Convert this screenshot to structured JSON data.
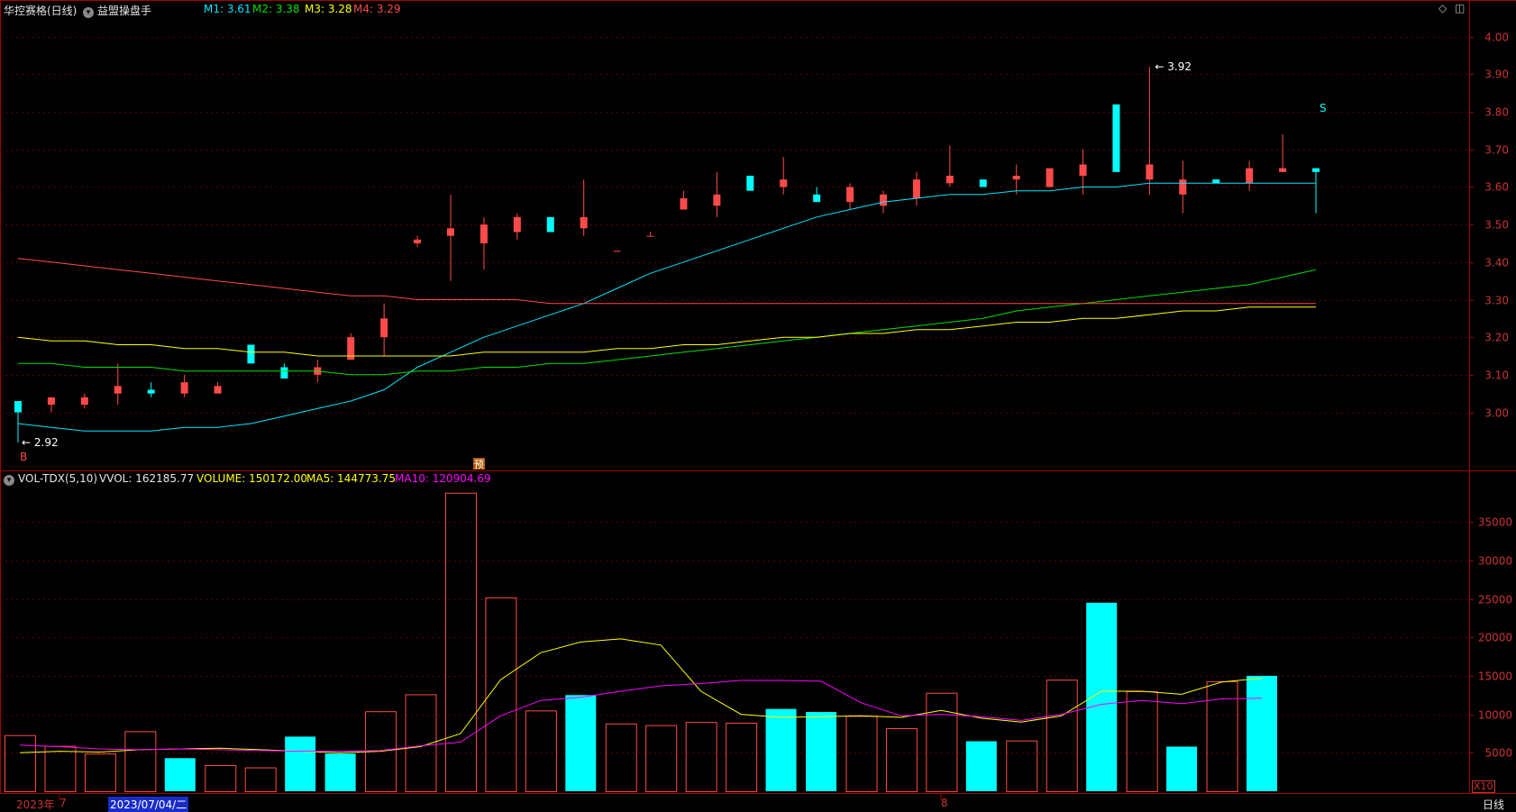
{
  "header": {
    "stock_name": "华控赛格(日线)",
    "indicator_name": "益盟操盘手",
    "ma_values": [
      {
        "label": "M1: 3.61",
        "color": "#00e5ff"
      },
      {
        "label": "M2: 3.38",
        "color": "#00e000"
      },
      {
        "label": "M3: 3.28",
        "color": "#ffff00"
      },
      {
        "label": "M4: 3.29",
        "color": "#ff4a4a"
      }
    ],
    "right_icons": [
      "diamond-icon",
      "panel-toggle-icon"
    ]
  },
  "volume_header": {
    "indicator": "VOL-TDX(5,10)",
    "vvol": "VVOL: 162185.77",
    "volume": "VOLUME: 150172.00",
    "ma5": "MA5: 144773.75",
    "ma10": "MA10: 120904.69"
  },
  "markers": {
    "low_label": "2.92",
    "high_label": "3.92",
    "buy_marker": "B",
    "sell_marker": "S",
    "pre_marker": "预"
  },
  "bottom_bar": {
    "year_label": "2023年",
    "month_start": "7",
    "cursor_date": "2023/07/04/二",
    "month_mid": "8",
    "period_label": "日线",
    "scale_label": "X10"
  },
  "colors": {
    "up": "#ff4a4a",
    "down": "#00ffff",
    "m1": "#00e5ff",
    "m2": "#00e000",
    "m3": "#ffff00",
    "m4": "#ff4a4a",
    "ma5": "#ffff00",
    "ma10": "#ff00ff",
    "axis": "#a00000"
  },
  "chart_data": [
    {
      "type": "candlestick",
      "title": "华控赛格(日线)",
      "ylim": [
        2.85,
        4.05
      ],
      "yticks": [
        "4.00",
        "3.90",
        "3.80",
        "3.70",
        "3.60",
        "3.50",
        "3.40",
        "3.30",
        "3.20",
        "3.10",
        "3.00"
      ],
      "candles": [
        {
          "o": 3.03,
          "c": 3.0,
          "h": 3.03,
          "l": 2.92
        },
        {
          "o": 3.02,
          "c": 3.04,
          "h": 3.04,
          "l": 3.0
        },
        {
          "o": 3.02,
          "c": 3.04,
          "h": 3.05,
          "l": 3.01
        },
        {
          "o": 3.05,
          "c": 3.07,
          "h": 3.13,
          "l": 3.02
        },
        {
          "o": 3.06,
          "c": 3.05,
          "h": 3.08,
          "l": 3.04
        },
        {
          "o": 3.05,
          "c": 3.08,
          "h": 3.1,
          "l": 3.04
        },
        {
          "o": 3.05,
          "c": 3.07,
          "h": 3.08,
          "l": 3.05
        },
        {
          "o": 3.18,
          "c": 3.13,
          "h": 3.18,
          "l": 3.13
        },
        {
          "o": 3.12,
          "c": 3.09,
          "h": 3.13,
          "l": 3.09
        },
        {
          "o": 3.1,
          "c": 3.12,
          "h": 3.14,
          "l": 3.08
        },
        {
          "o": 3.14,
          "c": 3.2,
          "h": 3.21,
          "l": 3.14
        },
        {
          "o": 3.2,
          "c": 3.25,
          "h": 3.29,
          "l": 3.15
        },
        {
          "o": 3.45,
          "c": 3.46,
          "h": 3.47,
          "l": 3.44
        },
        {
          "o": 3.47,
          "c": 3.49,
          "h": 3.58,
          "l": 3.35
        },
        {
          "o": 3.45,
          "c": 3.5,
          "h": 3.52,
          "l": 3.38
        },
        {
          "o": 3.48,
          "c": 3.52,
          "h": 3.53,
          "l": 3.46
        },
        {
          "o": 3.52,
          "c": 3.48,
          "h": 3.52,
          "l": 3.48
        },
        {
          "o": 3.49,
          "c": 3.52,
          "h": 3.62,
          "l": 3.47
        },
        {
          "o": 3.43,
          "c": 3.43,
          "h": 3.43,
          "l": 3.43
        },
        {
          "o": 3.47,
          "c": 3.47,
          "h": 3.48,
          "l": 3.47
        },
        {
          "o": 3.54,
          "c": 3.57,
          "h": 3.59,
          "l": 3.54
        },
        {
          "o": 3.55,
          "c": 3.58,
          "h": 3.64,
          "l": 3.52
        },
        {
          "o": 3.63,
          "c": 3.59,
          "h": 3.63,
          "l": 3.59
        },
        {
          "o": 3.6,
          "c": 3.62,
          "h": 3.68,
          "l": 3.58
        },
        {
          "o": 3.58,
          "c": 3.56,
          "h": 3.6,
          "l": 3.56
        },
        {
          "o": 3.56,
          "c": 3.6,
          "h": 3.61,
          "l": 3.54
        },
        {
          "o": 3.55,
          "c": 3.58,
          "h": 3.59,
          "l": 3.53
        },
        {
          "o": 3.57,
          "c": 3.62,
          "h": 3.64,
          "l": 3.55
        },
        {
          "o": 3.61,
          "c": 3.63,
          "h": 3.71,
          "l": 3.6
        },
        {
          "o": 3.62,
          "c": 3.6,
          "h": 3.62,
          "l": 3.6
        },
        {
          "o": 3.62,
          "c": 3.63,
          "h": 3.66,
          "l": 3.58
        },
        {
          "o": 3.6,
          "c": 3.65,
          "h": 3.65,
          "l": 3.6
        },
        {
          "o": 3.63,
          "c": 3.66,
          "h": 3.7,
          "l": 3.58
        },
        {
          "o": 3.82,
          "c": 3.64,
          "h": 3.82,
          "l": 3.64
        },
        {
          "o": 3.62,
          "c": 3.66,
          "h": 3.92,
          "l": 3.58
        },
        {
          "o": 3.58,
          "c": 3.62,
          "h": 3.67,
          "l": 3.53
        },
        {
          "o": 3.62,
          "c": 3.61,
          "h": 3.62,
          "l": 3.61
        },
        {
          "o": 3.61,
          "c": 3.65,
          "h": 3.67,
          "l": 3.59
        },
        {
          "o": 3.64,
          "c": 3.65,
          "h": 3.74,
          "l": 3.64
        },
        {
          "o": 3.65,
          "c": 3.64,
          "h": 3.65,
          "l": 3.53
        }
      ],
      "series": [
        {
          "name": "M1",
          "values": [
            2.97,
            2.96,
            2.95,
            2.95,
            2.95,
            2.96,
            2.96,
            2.97,
            2.99,
            3.01,
            3.03,
            3.06,
            3.12,
            3.16,
            3.2,
            3.23,
            3.26,
            3.29,
            3.33,
            3.37,
            3.4,
            3.43,
            3.46,
            3.49,
            3.52,
            3.54,
            3.56,
            3.57,
            3.58,
            3.58,
            3.59,
            3.59,
            3.6,
            3.6,
            3.61,
            3.61,
            3.61,
            3.61,
            3.61,
            3.61
          ]
        },
        {
          "name": "M2",
          "values": [
            3.13,
            3.13,
            3.12,
            3.12,
            3.12,
            3.11,
            3.11,
            3.11,
            3.11,
            3.11,
            3.1,
            3.1,
            3.11,
            3.11,
            3.12,
            3.12,
            3.13,
            3.13,
            3.14,
            3.15,
            3.16,
            3.17,
            3.18,
            3.19,
            3.2,
            3.21,
            3.22,
            3.23,
            3.24,
            3.25,
            3.27,
            3.28,
            3.29,
            3.3,
            3.31,
            3.32,
            3.33,
            3.34,
            3.36,
            3.38
          ]
        },
        {
          "name": "M3",
          "values": [
            3.2,
            3.19,
            3.19,
            3.18,
            3.18,
            3.17,
            3.17,
            3.16,
            3.16,
            3.15,
            3.15,
            3.15,
            3.15,
            3.15,
            3.16,
            3.16,
            3.16,
            3.16,
            3.17,
            3.17,
            3.18,
            3.18,
            3.19,
            3.2,
            3.2,
            3.21,
            3.21,
            3.22,
            3.22,
            3.23,
            3.24,
            3.24,
            3.25,
            3.25,
            3.26,
            3.27,
            3.27,
            3.28,
            3.28,
            3.28
          ]
        },
        {
          "name": "M4",
          "values": [
            3.41,
            3.4,
            3.39,
            3.38,
            3.37,
            3.36,
            3.35,
            3.34,
            3.33,
            3.32,
            3.31,
            3.31,
            3.3,
            3.3,
            3.3,
            3.3,
            3.29,
            3.29,
            3.29,
            3.29,
            3.29,
            3.29,
            3.29,
            3.29,
            3.29,
            3.29,
            3.29,
            3.29,
            3.29,
            3.29,
            3.29,
            3.29,
            3.29,
            3.29,
            3.29,
            3.29,
            3.29,
            3.29,
            3.29,
            3.29
          ]
        }
      ]
    },
    {
      "type": "bar",
      "title": "VOL-TDX(5,10)",
      "ylim": [
        0,
        39000
      ],
      "yticks": [
        35000,
        30000,
        25000,
        20000,
        15000,
        10000,
        5000
      ],
      "values": [
        7300,
        5900,
        4900,
        7800,
        4300,
        3400,
        3100,
        7100,
        4900,
        10400,
        12600,
        38800,
        25200,
        10500,
        12500,
        8800,
        8600,
        9000,
        8900,
        10700,
        10300,
        9800,
        8200,
        12800,
        6500,
        6600,
        14500,
        24500,
        13000,
        5800,
        14300,
        15000
      ],
      "direction": [
        "up",
        "up",
        "up",
        "up",
        "down",
        "up",
        "up",
        "down",
        "down",
        "up",
        "up",
        "up",
        "up",
        "up",
        "down",
        "up",
        "up",
        "up",
        "up",
        "down",
        "down",
        "up",
        "up",
        "up",
        "down",
        "up",
        "up",
        "down",
        "up",
        "down",
        "up",
        "down"
      ],
      "series": [
        {
          "name": "MA5",
          "values": [
            5000,
            5200,
            5100,
            5400,
            5500,
            5600,
            5400,
            5200,
            5000,
            5200,
            5800,
            7500,
            14500,
            18000,
            19400,
            19800,
            19000,
            13000,
            10000,
            9600,
            9700,
            9800,
            9600,
            10500,
            9500,
            9000,
            9800,
            13000,
            13000,
            12600,
            14200,
            14700
          ]
        },
        {
          "name": "MA10",
          "values": [
            6000,
            5800,
            5500,
            5400,
            5500,
            5400,
            5300,
            5200,
            5200,
            5300,
            5900,
            6400,
            9800,
            11800,
            12200,
            13000,
            13700,
            14000,
            14400,
            14400,
            14300,
            11500,
            9800,
            10000,
            9700,
            9200,
            10000,
            11300,
            11800,
            11400,
            12000,
            12100
          ]
        }
      ]
    }
  ]
}
